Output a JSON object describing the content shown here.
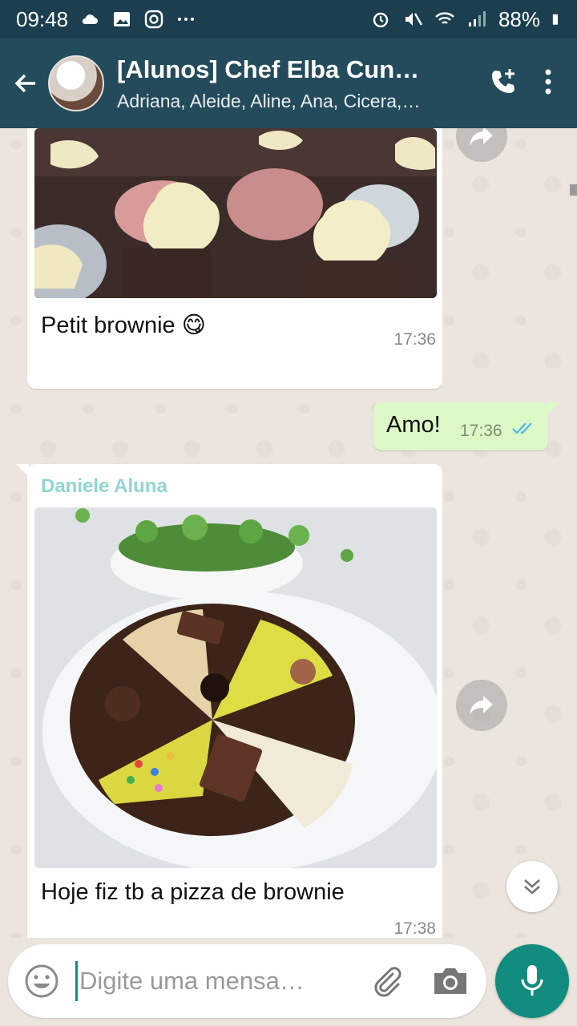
{
  "status_bar": {
    "time": "09:48",
    "battery": "88%",
    "icons": [
      "cloud-icon",
      "image-icon",
      "instagram-icon",
      "more-dots-icon",
      "alarm-icon",
      "mute-icon",
      "wifi-icon",
      "signal-icon",
      "battery-icon"
    ]
  },
  "header": {
    "title": "[Alunos] Chef Elba Cun…",
    "subtitle": "Adriana, Aleide, Aline, Ana, Cicera,…",
    "actions": [
      "add-call-icon",
      "more-vert-icon"
    ]
  },
  "messages": [
    {
      "direction": "in",
      "type": "image",
      "image_description": "photo-petit-brownies",
      "caption": "Petit brownie 😋",
      "time": "17:36"
    },
    {
      "direction": "out",
      "type": "text",
      "text": "Amo!",
      "time": "17:36",
      "status": "read"
    },
    {
      "direction": "in",
      "type": "image",
      "sender": "Daniele Aluna",
      "image_description": "photo-brownie-pizza",
      "caption": "Hoje fiz tb a pizza de brownie",
      "time": "17:38"
    }
  ],
  "composer": {
    "placeholder": "Digite uma mensa…",
    "value": ""
  },
  "colors": {
    "status_bar": "#1c3f4f",
    "header": "#244b5b",
    "chat_bg": "#ece5dd",
    "outgoing_bubble": "#dcf8c6",
    "sender_name": "#8fd6cf",
    "mic_button": "#128c7e",
    "read_ticks": "#4fb6ec"
  }
}
